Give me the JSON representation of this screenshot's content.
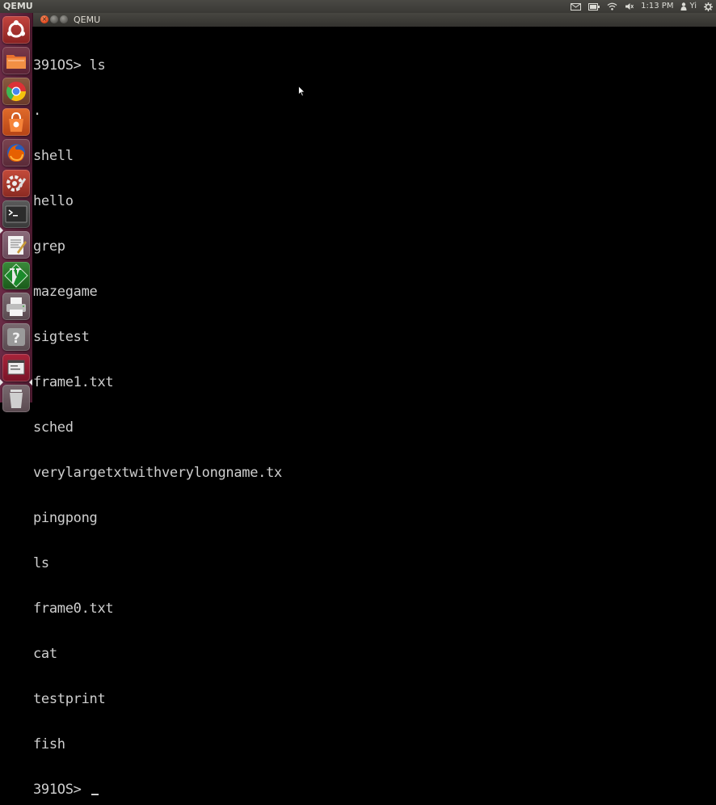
{
  "top_panel": {
    "app_title": "QEMU",
    "time": "1:13 PM",
    "user": "Yi",
    "indicators": [
      "mail-icon",
      "battery-icon",
      "wifi-icon",
      "volume-icon",
      "user-icon",
      "gear-icon"
    ]
  },
  "window": {
    "title": "QEMU",
    "close_glyph": "×",
    "buttons": [
      "close",
      "minimize",
      "maximize"
    ]
  },
  "launcher": {
    "items": [
      {
        "name": "dash",
        "icon": "ubuntu-logo-icon"
      },
      {
        "name": "files",
        "icon": "folder-icon"
      },
      {
        "name": "chrome",
        "icon": "chrome-icon"
      },
      {
        "name": "software-center",
        "icon": "shopping-bag-icon"
      },
      {
        "name": "firefox",
        "icon": "firefox-icon"
      },
      {
        "name": "system-settings",
        "icon": "settings-icon"
      },
      {
        "name": "terminal",
        "icon": "terminal-icon"
      },
      {
        "name": "text-editor",
        "icon": "text-editor-icon"
      },
      {
        "name": "vim",
        "icon": "vim-icon"
      },
      {
        "name": "printer",
        "icon": "printer-icon"
      },
      {
        "name": "help",
        "icon": "help-icon"
      },
      {
        "name": "qemu",
        "icon": "qemu-window-icon"
      },
      {
        "name": "trash",
        "icon": "trash-icon"
      }
    ]
  },
  "terminal": {
    "lines": [
      "391OS> ls",
      ".",
      "shell",
      "hello",
      "grep",
      "mazegame",
      "sigtest",
      "frame1.txt",
      "sched",
      "verylargetxtwithverylongname.tx",
      "pingpong",
      "ls",
      "frame0.txt",
      "cat",
      "testprint",
      "fish"
    ],
    "prompt": "391OS> "
  }
}
